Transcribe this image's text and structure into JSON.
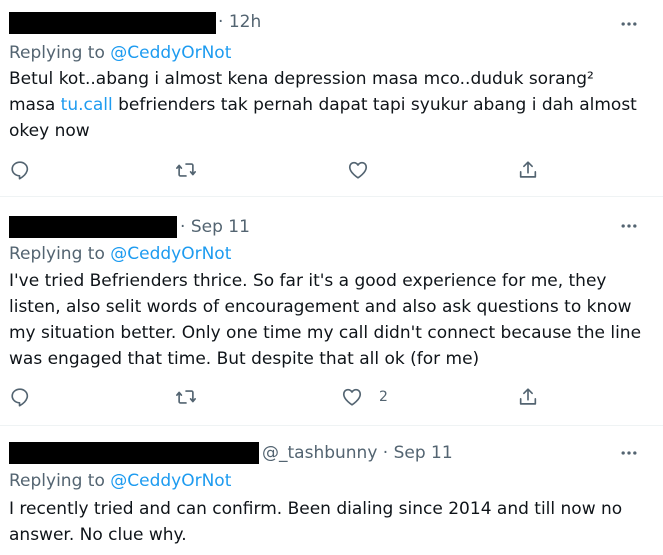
{
  "tweets": [
    {
      "time": "12h",
      "replying_prefix": "Replying to",
      "replying_handle": "@CeddyOrNot",
      "text_pre": "Betul kot..abang i almost kena depression masa mco..duduk sorang² masa ",
      "text_link": "tu.call",
      "text_post": " befrienders tak pernah dapat tapi syukur abang i dah almost okey now",
      "like_count": ""
    },
    {
      "time": "Sep 11",
      "replying_prefix": "Replying to",
      "replying_handle": "@CeddyOrNot",
      "text": "I've tried Befrienders thrice. So far it's a good experience for me, they listen, also selit words of encouragement and also ask questions to know my situation better. Only one time my call didn't connect because the line was engaged that time. But despite that all ok (for me)",
      "like_count": "2"
    },
    {
      "handle": "@_tashbunny",
      "time": "Sep 11",
      "replying_prefix": "Replying to",
      "replying_handle": "@CeddyOrNot",
      "text": "I recently tried and can confirm. Been dialing since 2014 and till now no answer. No clue why."
    }
  ],
  "separator": "·",
  "icons": [
    "more-icon",
    "reply-icon",
    "retweet-icon",
    "like-icon",
    "share-icon"
  ],
  "colors": {
    "link": "#1d9bf0",
    "muted": "#536471",
    "text": "#0f1419",
    "divider": "#eff3f4"
  }
}
